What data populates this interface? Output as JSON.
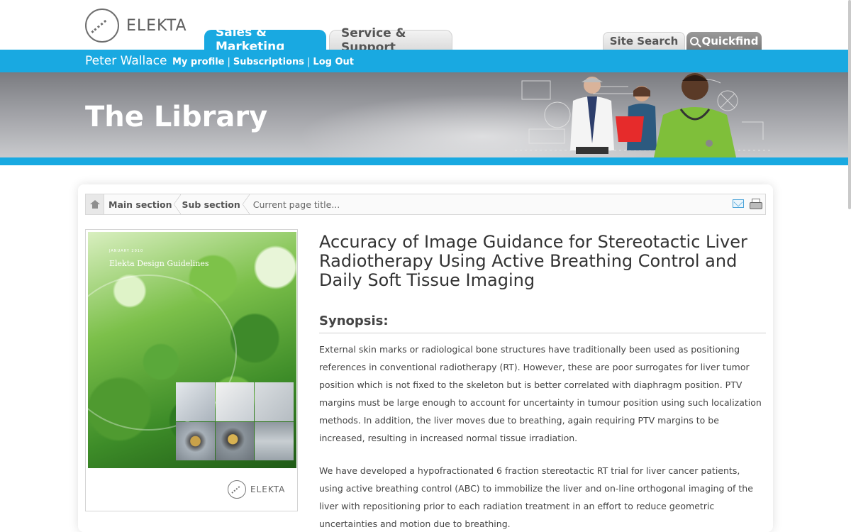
{
  "header": {
    "logo_text": "ELEKTA",
    "tabs": [
      {
        "label": "Sales & Marketing",
        "active": true
      },
      {
        "label": "Service & Support",
        "active": false
      }
    ],
    "site_search_label": "Site Search",
    "quickfind_label": "Quickfind"
  },
  "userbar": {
    "name": "Peter Wallace",
    "links": [
      "My profile",
      "Subscriptions",
      "Log Out"
    ],
    "separator": "|"
  },
  "banner": {
    "title": "The Library"
  },
  "breadcrumb": {
    "items": [
      "Main section",
      "Sub section"
    ],
    "current": "Current page title..."
  },
  "cover": {
    "date": "JANUARY 2010",
    "title": "Elekta Design Guidelines",
    "logo_text": "ELEKTA"
  },
  "article": {
    "title": "Accuracy of Image Guidance for Stereotactic Liver Radiotherapy Using Active Breathing Control and Daily Soft Tissue Imaging",
    "synopsis_heading": "Synopsis:",
    "paragraphs": [
      "External skin marks or radiological bone structures have traditionally been used as positioning references in conventional radiotherapy (RT). However, these are poor surrogates for liver tumor position which is not fixed to the skeleton but is better correlated with diaphragm position. PTV margins must be large enough to account for uncertainty in tumour position using such localization methods. In addition, the liver moves due to breathing, again requiring PTV margins to be increased, resulting in increased normal tissue irradiation.",
      "We have developed a hypofractionated 6 fraction stereotactic RT trial for liver cancer patients, using active breathing control (ABC) to immobilize the liver and on-line orthogonal imaging of the liver with repositioning prior to each radiation treatment in an effort to reduce geometric uncertainties and motion due to breathing."
    ]
  },
  "colors": {
    "brand_blue": "#19a9e1",
    "banner_gray": "#8a8b90"
  }
}
